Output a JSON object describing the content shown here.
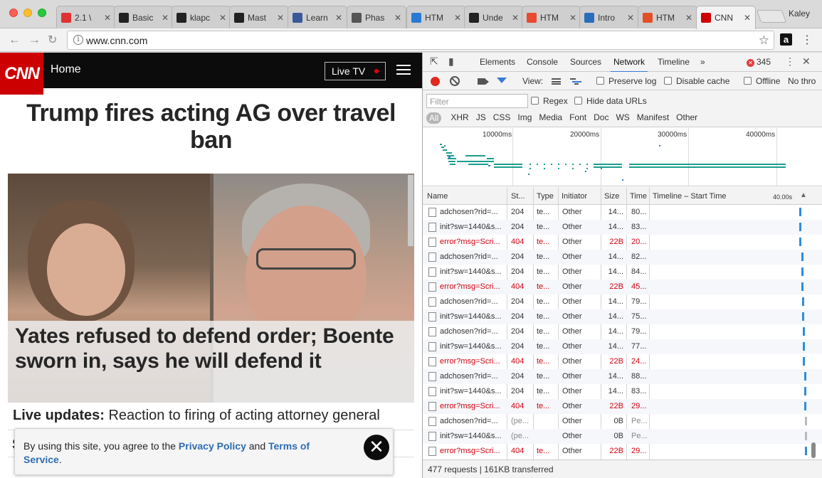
{
  "browser": {
    "tabs": [
      {
        "label": "2.1 \\",
        "icon": "loading-icon",
        "color": "#d33"
      },
      {
        "label": "Basic",
        "icon": "github-icon",
        "color": "#222"
      },
      {
        "label": "klapc",
        "icon": "github-icon",
        "color": "#222"
      },
      {
        "label": "Mast",
        "icon": "github-icon",
        "color": "#222"
      },
      {
        "label": "Learn",
        "icon": "learn-icon",
        "color": "#3b5998"
      },
      {
        "label": "Phas",
        "icon": "code-icon",
        "color": "#555"
      },
      {
        "label": "HTM",
        "icon": "html-doc-icon",
        "color": "#2a7ad5"
      },
      {
        "label": "Unde",
        "icon": "github-icon",
        "color": "#222"
      },
      {
        "label": "HTM",
        "icon": "s-brand-icon",
        "color": "#e8492f"
      },
      {
        "label": "Intro",
        "icon": "intro-icon",
        "color": "#2a6ebb"
      },
      {
        "label": "HTM",
        "icon": "html5-icon",
        "color": "#e34f26"
      },
      {
        "label": "CNN",
        "icon": "cnn-icon",
        "color": "#cc0000"
      }
    ],
    "profile": "Kaley",
    "url": "www.cnn.com"
  },
  "cnn": {
    "logo": "CNN",
    "section": "Home",
    "live_tv": "Live TV",
    "headline": "Trump fires acting AG over travel ban",
    "subhead": "Yates refused to defend order; Boente sworn in, says he will defend it",
    "live_label": "Live updates:",
    "live_text": " Reaction to firing of acting attorney general",
    "peek_text": "S",
    "cookie": {
      "prefix": "By using this site, you agree to the ",
      "privacy": "Privacy Policy",
      "and": " and ",
      "terms": "Terms of Service",
      "suffix": "."
    }
  },
  "devtools": {
    "tabs": [
      "Elements",
      "Console",
      "Sources",
      "Network",
      "Timeline"
    ],
    "active_tab": "Network",
    "more": "»",
    "error_count": "345",
    "toolbar": {
      "view_label": "View:",
      "preserve_log": "Preserve log",
      "disable_cache": "Disable cache",
      "offline": "Offline",
      "throttle": "No thro"
    },
    "filter": {
      "placeholder": "Filter",
      "regex": "Regex",
      "hide_data_urls": "Hide data URLs",
      "types": [
        "All",
        "XHR",
        "JS",
        "CSS",
        "Img",
        "Media",
        "Font",
        "Doc",
        "WS",
        "Manifest",
        "Other"
      ]
    },
    "overview_ticks": [
      "10000ms",
      "20000ms",
      "30000ms",
      "40000ms"
    ],
    "columns": [
      "Name",
      "St...",
      "Type",
      "Initiator",
      "Size",
      "Time",
      "Timeline – Start Time",
      "40.00s"
    ],
    "rows": [
      {
        "name": "adchosen?rid=...",
        "status": "204",
        "type": "te...",
        "initiator": "Other",
        "size": "14...",
        "time": "80...",
        "error": false,
        "bar": 0.93
      },
      {
        "name": "init?sw=1440&s...",
        "status": "204",
        "type": "te...",
        "initiator": "Other",
        "size": "14...",
        "time": "83...",
        "error": false,
        "bar": 0.93
      },
      {
        "name": "error?msg=Scri...",
        "status": "404",
        "type": "te...",
        "initiator": "Other",
        "size": "22B",
        "time": "20...",
        "error": true,
        "bar": 0.93
      },
      {
        "name": "adchosen?rid=...",
        "status": "204",
        "type": "te...",
        "initiator": "Other",
        "size": "14...",
        "time": "82...",
        "error": false,
        "bar": 0.94
      },
      {
        "name": "init?sw=1440&s...",
        "status": "204",
        "type": "te...",
        "initiator": "Other",
        "size": "14...",
        "time": "84...",
        "error": false,
        "bar": 0.94
      },
      {
        "name": "error?msg=Scri...",
        "status": "404",
        "type": "te...",
        "initiator": "Other",
        "size": "22B",
        "time": "45...",
        "error": true,
        "bar": 0.94
      },
      {
        "name": "adchosen?rid=...",
        "status": "204",
        "type": "te...",
        "initiator": "Other",
        "size": "14...",
        "time": "79...",
        "error": false,
        "bar": 0.945
      },
      {
        "name": "init?sw=1440&s...",
        "status": "204",
        "type": "te...",
        "initiator": "Other",
        "size": "14...",
        "time": "75...",
        "error": false,
        "bar": 0.945
      },
      {
        "name": "adchosen?rid=...",
        "status": "204",
        "type": "te...",
        "initiator": "Other",
        "size": "14...",
        "time": "79...",
        "error": false,
        "bar": 0.95
      },
      {
        "name": "init?sw=1440&s...",
        "status": "204",
        "type": "te...",
        "initiator": "Other",
        "size": "14...",
        "time": "77...",
        "error": false,
        "bar": 0.95
      },
      {
        "name": "error?msg=Scri...",
        "status": "404",
        "type": "te...",
        "initiator": "Other",
        "size": "22B",
        "time": "24...",
        "error": true,
        "bar": 0.95
      },
      {
        "name": "adchosen?rid=...",
        "status": "204",
        "type": "te...",
        "initiator": "Other",
        "size": "14...",
        "time": "88...",
        "error": false,
        "bar": 0.96
      },
      {
        "name": "init?sw=1440&s...",
        "status": "204",
        "type": "te...",
        "initiator": "Other",
        "size": "14...",
        "time": "83...",
        "error": false,
        "bar": 0.96
      },
      {
        "name": "error?msg=Scri...",
        "status": "404",
        "type": "te...",
        "initiator": "Other",
        "size": "22B",
        "time": "29...",
        "error": true,
        "bar": 0.96
      },
      {
        "name": "adchosen?rid=...",
        "status": "(pe...",
        "type": "",
        "initiator": "Other",
        "size": "0B",
        "time": "Pe...",
        "error": false,
        "pending": true,
        "bar": 0.965
      },
      {
        "name": "init?sw=1440&s...",
        "status": "(pe...",
        "type": "",
        "initiator": "Other",
        "size": "0B",
        "time": "Pe...",
        "error": false,
        "pending": true,
        "bar": 0.965
      },
      {
        "name": "error?msg=Scri...",
        "status": "404",
        "type": "te...",
        "initiator": "Other",
        "size": "22B",
        "time": "29...",
        "error": true,
        "bar": 0.965
      }
    ],
    "status_bar": "477 requests | 161KB transferred"
  }
}
